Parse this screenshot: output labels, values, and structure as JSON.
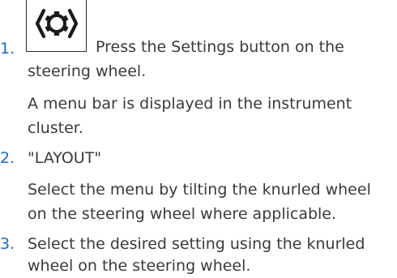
{
  "accent_color": "#1c69d4",
  "text_color": "#3a3a3a",
  "steps": [
    {
      "number": "1.",
      "icon": "settings-gear-icon",
      "lines": [
        "Press the Settings button on the",
        "steering wheel."
      ],
      "result_lines": [
        "A menu bar is displayed in the instrument",
        "cluster."
      ]
    },
    {
      "number": "2.",
      "lines": [
        "\"LAYOUT\""
      ],
      "result_lines": [
        "Select the menu by tilting the knurled wheel",
        "on the steering wheel where applicable."
      ]
    },
    {
      "number": "3.",
      "lines": [
        "Select the desired setting using the knurled",
        "wheel on the steering wheel."
      ]
    }
  ]
}
